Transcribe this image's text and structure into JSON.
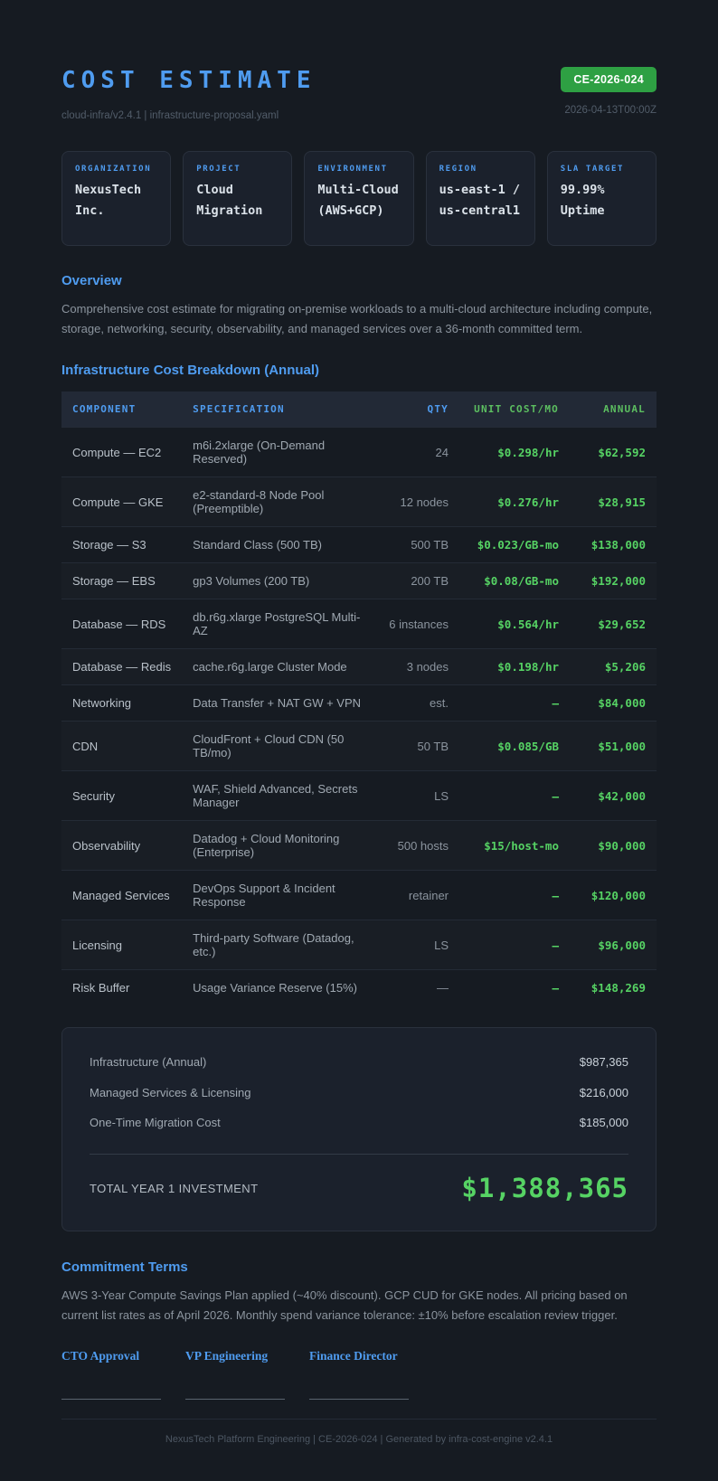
{
  "header": {
    "title": "COST ESTIMATE",
    "subtitle": "cloud-infra/v2.4.1 | infrastructure-proposal.yaml",
    "badge": "CE-2026-024",
    "timestamp": "2026-04-13T00:00Z"
  },
  "meta_cards": [
    {
      "label": "ORGANIZATION",
      "value": "NexusTech Inc."
    },
    {
      "label": "PROJECT",
      "value": "Cloud Migration"
    },
    {
      "label": "ENVIRONMENT",
      "value": "Multi-Cloud (AWS+GCP)"
    },
    {
      "label": "REGION",
      "value": "us-east-1 / us-central1"
    },
    {
      "label": "SLA TARGET",
      "value": "99.99% Uptime"
    }
  ],
  "overview": {
    "heading": "Overview",
    "body": "Comprehensive cost estimate for migrating on-premise workloads to a multi-cloud architecture including compute, storage, networking, security, observability, and managed services over a 36-month committed term."
  },
  "breakdown": {
    "heading": "Infrastructure Cost Breakdown (Annual)",
    "columns": [
      "COMPONENT",
      "SPECIFICATION",
      "QTY",
      "UNIT COST/MO",
      "ANNUAL"
    ],
    "rows": [
      {
        "component": "Compute — EC2",
        "specification": "m6i.2xlarge (On-Demand Reserved)",
        "qty": "24",
        "unit_cost": "$0.298/hr",
        "annual": "$62,592"
      },
      {
        "component": "Compute — GKE",
        "specification": "e2-standard-8 Node Pool (Preemptible)",
        "qty": "12 nodes",
        "unit_cost": "$0.276/hr",
        "annual": "$28,915"
      },
      {
        "component": "Storage — S3",
        "specification": "Standard Class (500 TB)",
        "qty": "500 TB",
        "unit_cost": "$0.023/GB-mo",
        "annual": "$138,000"
      },
      {
        "component": "Storage — EBS",
        "specification": "gp3 Volumes (200 TB)",
        "qty": "200 TB",
        "unit_cost": "$0.08/GB-mo",
        "annual": "$192,000"
      },
      {
        "component": "Database — RDS",
        "specification": "db.r6g.xlarge PostgreSQL Multi-AZ",
        "qty": "6 instances",
        "unit_cost": "$0.564/hr",
        "annual": "$29,652"
      },
      {
        "component": "Database — Redis",
        "specification": "cache.r6g.large Cluster Mode",
        "qty": "3 nodes",
        "unit_cost": "$0.198/hr",
        "annual": "$5,206"
      },
      {
        "component": "Networking",
        "specification": "Data Transfer + NAT GW + VPN",
        "qty": "est.",
        "unit_cost": "–",
        "annual": "$84,000"
      },
      {
        "component": "CDN",
        "specification": "CloudFront + Cloud CDN (50 TB/mo)",
        "qty": "50 TB",
        "unit_cost": "$0.085/GB",
        "annual": "$51,000"
      },
      {
        "component": "Security",
        "specification": "WAF, Shield Advanced, Secrets Manager",
        "qty": "LS",
        "unit_cost": "–",
        "annual": "$42,000"
      },
      {
        "component": "Observability",
        "specification": "Datadog + Cloud Monitoring (Enterprise)",
        "qty": "500 hosts",
        "unit_cost": "$15/host-mo",
        "annual": "$90,000"
      },
      {
        "component": "Managed Services",
        "specification": "DevOps Support & Incident Response",
        "qty": "retainer",
        "unit_cost": "–",
        "annual": "$120,000"
      },
      {
        "component": "Licensing",
        "specification": "Third-party Software (Datadog, etc.)",
        "qty": "LS",
        "unit_cost": "–",
        "annual": "$96,000"
      },
      {
        "component": "Risk Buffer",
        "specification": "Usage Variance Reserve (15%)",
        "qty": "—",
        "unit_cost": "–",
        "annual": "$148,269"
      }
    ]
  },
  "summary": {
    "lines": [
      {
        "label": "Infrastructure (Annual)",
        "value": "$987,365"
      },
      {
        "label": "Managed Services & Licensing",
        "value": "$216,000"
      },
      {
        "label": "One-Time Migration Cost",
        "value": "$185,000"
      }
    ],
    "total_label": "TOTAL YEAR 1 INVESTMENT",
    "total_value": "$1,388,365"
  },
  "commitment": {
    "heading": "Commitment Terms",
    "body": "AWS 3-Year Compute Savings Plan applied (~40% discount). GCP CUD for GKE nodes. All pricing based on current list rates as of April 2026. Monthly spend variance tolerance: ±10% before escalation review trigger."
  },
  "signatures": [
    {
      "label": "CTO Approval"
    },
    {
      "label": "VP Engineering"
    },
    {
      "label": "Finance Director"
    }
  ],
  "footer": "NexusTech Platform Engineering | CE-2026-024 | Generated by infra-cost-engine v2.4.1",
  "colors": {
    "accent_blue": "#4f9cf0",
    "money_green": "#56d364",
    "badge_green": "#2ea043",
    "page_background": "#161b22"
  }
}
